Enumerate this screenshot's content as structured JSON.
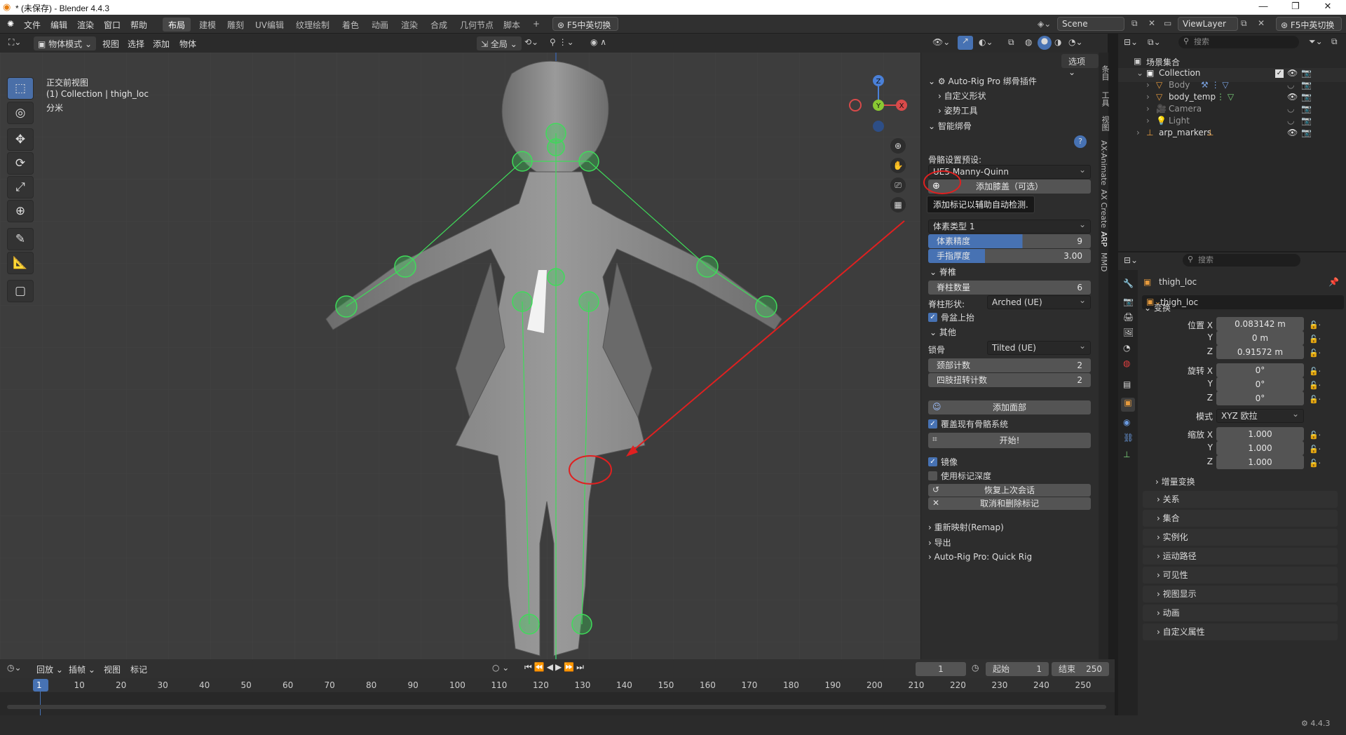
{
  "window": {
    "title": "* (未保存) - Blender 4.4.3"
  },
  "menu": {
    "items": [
      "文件",
      "编辑",
      "渲染",
      "窗口",
      "帮助"
    ]
  },
  "workspaces": {
    "tabs": [
      "布局",
      "建模",
      "雕刻",
      "UV编辑",
      "纹理绘制",
      "着色",
      "动画",
      "渲染",
      "合成",
      "几何节点",
      "脚本"
    ],
    "add": "+"
  },
  "ime_toggle": "F5中英切换",
  "scene": {
    "name": "Scene",
    "viewlayer": "ViewLayer"
  },
  "viewport_header": {
    "mode": "物体模式",
    "menus": [
      "视图",
      "选择",
      "添加",
      "物体"
    ],
    "transform": "全局",
    "options": "选项"
  },
  "overlay_text": {
    "view": "正交前视图",
    "collection": "(1) Collection | thigh_loc",
    "unit": "分米"
  },
  "gizmo": {
    "x": "X",
    "y": "Y",
    "z": "Z"
  },
  "npanel": {
    "plugin_title": "Auto-Rig Pro 绑骨插件",
    "custom_shapes": "自定义形状",
    "pose_tools": "姿势工具",
    "smart_rig": "智能绑骨",
    "help": "?",
    "preset_label": "骨骼设置预设:",
    "preset_value": "UE5 Manny-Quinn",
    "add_knee": "添加膝盖（可选）",
    "tooltip": "添加标记以辅助自动检测.",
    "voxel_type": "体素类型 1",
    "voxel_precision_label": "体素精度",
    "voxel_precision_value": "9",
    "finger_thickness_label": "手指厚度",
    "finger_thickness_value": "3.00",
    "spine_section": "脊椎",
    "spine_count_label": "脊柱数量",
    "spine_count_value": "6",
    "spine_shape_label": "脊柱形状:",
    "spine_shape_value": "Arched (UE)",
    "pelvis_up": "骨盆上抬",
    "other_section": "其他",
    "clavicle_label": "锁骨",
    "clavicle_value": "Tilted (UE)",
    "neck_count_label": "颈部计数",
    "neck_count_value": "2",
    "limb_twist_label": "四肢扭转计数",
    "limb_twist_value": "2",
    "add_face": "添加面部",
    "overwrite": "覆盖现有骨骼系统",
    "start": "开始!",
    "mirror": "镜像",
    "use_marker_depth": "使用标记深度",
    "restore_session": "恢复上次会话",
    "cancel_delete": "取消和删除标记",
    "remap": "重新映射(Remap)",
    "export": "导出",
    "quick_rig": "Auto-Rig Pro: Quick Rig"
  },
  "vtabs": [
    "条目",
    "工具",
    "视图",
    "AX-Animate",
    "AX Create",
    "ARP",
    "MMD"
  ],
  "outliner": {
    "search_placeholder": "搜索",
    "root": "场景集合",
    "items": [
      "Collection",
      "Body",
      "body_temp",
      "Camera",
      "Light",
      "arp_markers"
    ]
  },
  "properties": {
    "search_placeholder": "搜索",
    "object_name": "thigh_loc",
    "object_name_field": "thigh_loc",
    "transform": "变换",
    "loc_label": "位置 X",
    "loc_x": "0.083142 m",
    "loc_y": "0 m",
    "loc_z": "0.91572 m",
    "rot_label": "旋转 X",
    "rot_x": "0°",
    "rot_y": "0°",
    "rot_z": "0°",
    "mode_label": "模式",
    "mode_value": "XYZ 欧拉",
    "scale_label": "缩放 X",
    "scale_x": "1.000",
    "scale_y": "1.000",
    "scale_z": "1.000",
    "y": "Y",
    "z": "Z",
    "delta": "增量变换",
    "sections": [
      "关系",
      "集合",
      "实例化",
      "运动路径",
      "可见性",
      "视图显示",
      "动画",
      "自定义属性"
    ]
  },
  "timeline": {
    "menus": [
      "回放",
      "插帧",
      "视图",
      "标记"
    ],
    "current": "1",
    "start_label": "起始",
    "start": "1",
    "end_label": "结束",
    "end": "250",
    "ticks": [
      "1",
      "10",
      "20",
      "30",
      "40",
      "50",
      "60",
      "70",
      "80",
      "90",
      "100",
      "110",
      "120",
      "130",
      "140",
      "150",
      "160",
      "170",
      "180",
      "190",
      "200",
      "210",
      "220",
      "230",
      "240",
      "250"
    ]
  },
  "status": {
    "version": "4.4.3"
  },
  "colors": {
    "accent": "#4772b3",
    "bone": "#3fdc5a",
    "annotation": "#e02020"
  }
}
